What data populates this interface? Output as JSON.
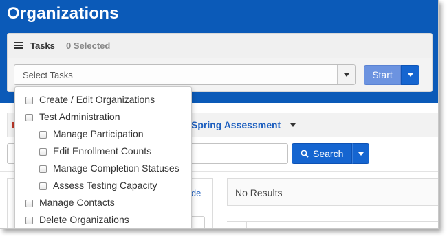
{
  "header": {
    "title": "Organizations"
  },
  "tasks": {
    "title": "Tasks",
    "selected_count": "0 Selected",
    "select_placeholder": "Select Tasks",
    "start_label": "Start"
  },
  "dropdown": {
    "items": [
      {
        "label": "Create / Edit Organizations",
        "level": 0
      },
      {
        "label": "Test Administration",
        "level": 0
      },
      {
        "label": "Manage Participation",
        "level": 1
      },
      {
        "label": "Edit Enrollment Counts",
        "level": 1
      },
      {
        "label": "Manage Completion Statuses",
        "level": 1
      },
      {
        "label": "Assess Testing Capacity",
        "level": 1
      },
      {
        "label": "Manage Contacts",
        "level": 0
      },
      {
        "label": "Delete Organizations",
        "level": 0
      }
    ]
  },
  "filter": {
    "assessment_label": "Spring Assessment"
  },
  "search": {
    "button_label": "Search"
  },
  "left_panel": {
    "hide_link": "ide"
  },
  "results": {
    "status": "No Results"
  },
  "colors": {
    "header_bg": "#0b5ab8",
    "primary": "#1565d0",
    "link": "#1d5fbf"
  }
}
